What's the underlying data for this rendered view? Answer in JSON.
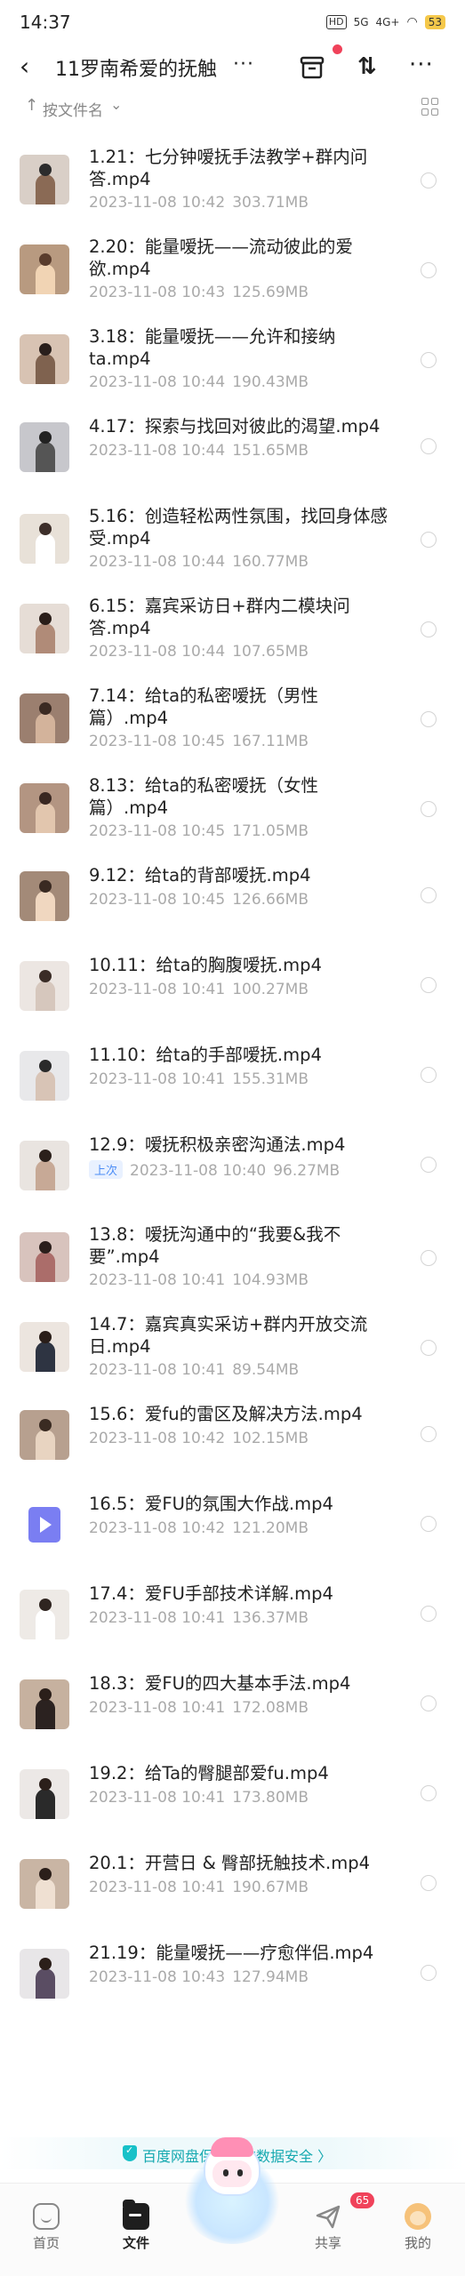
{
  "status_bar": {
    "time": "14:37",
    "hd": "HD",
    "sig1": "5G",
    "sig2": "4G+",
    "battery": "53"
  },
  "title_bar": {
    "title": "11罗南希爱的抚触",
    "ellipsis": "···",
    "sort_icon": "⇅",
    "more": "···"
  },
  "sort_bar": {
    "label": "按文件名",
    "arrow": "↑",
    "chevron": "⌄"
  },
  "files": [
    {
      "name": "1.21：七分钟嗳抚手法教学+群内问答.mp4",
      "date": "2023-11-08  10:42",
      "size": "303.71MB",
      "lines": 2
    },
    {
      "name": "2.20：能量嗳抚——流动彼此的爱欲.mp4",
      "date": "2023-11-08  10:43",
      "size": "125.69MB",
      "lines": 2
    },
    {
      "name": "3.18：能量嗳抚——允许和接纳ta.mp4",
      "date": "2023-11-08  10:44",
      "size": "190.43MB",
      "lines": 2
    },
    {
      "name": "4.17：探索与找回对彼此的渴望.mp4",
      "date": "2023-11-08  10:44",
      "size": "151.65MB",
      "lines": 1
    },
    {
      "name": "5.16：创造轻松两性氛围，找回身体感受.mp4",
      "date": "2023-11-08  10:44",
      "size": "160.77MB",
      "lines": 2
    },
    {
      "name": "6.15：嘉宾采访日+群内二模块问答.mp4",
      "date": "2023-11-08  10:44",
      "size": "107.65MB",
      "lines": 2
    },
    {
      "name": "7.14：给ta的私密嗳抚（男性篇）.mp4",
      "date": "2023-11-08  10:45",
      "size": "167.11MB",
      "lines": 2
    },
    {
      "name": "8.13：给ta的私密嗳抚（女性篇）.mp4",
      "date": "2023-11-08  10:45",
      "size": "171.05MB",
      "lines": 2
    },
    {
      "name": "9.12：给ta的背部嗳抚.mp4",
      "date": "2023-11-08  10:45",
      "size": "126.66MB",
      "lines": 1
    },
    {
      "name": "10.11：给ta的胸腹嗳抚.mp4",
      "date": "2023-11-08  10:41",
      "size": "100.27MB",
      "lines": 1
    },
    {
      "name": "11.10：给ta的手部嗳抚.mp4",
      "date": "2023-11-08  10:41",
      "size": "155.31MB",
      "lines": 1
    },
    {
      "name": "12.9：嗳抚积极亲密沟通法.mp4",
      "date": "2023-11-08  10:40",
      "size": "96.27MB",
      "lines": 1,
      "tag": "上次"
    },
    {
      "name": "13.8：嗳抚沟通中的“我要&我不要”.mp4",
      "date": "2023-11-08  10:41",
      "size": "104.93MB",
      "lines": 2
    },
    {
      "name": "14.7：嘉宾真实采访+群内开放交流日.mp4",
      "date": "2023-11-08  10:41",
      "size": "89.54MB",
      "lines": 2
    },
    {
      "name": "15.6：爱fu的雷区及解决方法.mp4",
      "date": "2023-11-08  10:42",
      "size": "102.15MB",
      "lines": 1
    },
    {
      "name": "16.5：爱FU的氛围大作战.mp4",
      "date": "2023-11-08  10:42",
      "size": "121.20MB",
      "lines": 1,
      "video_icon": true
    },
    {
      "name": "17.4：爱FU手部技术详解.mp4",
      "date": "2023-11-08  10:41",
      "size": "136.37MB",
      "lines": 1
    },
    {
      "name": "18.3：爱FU的四大基本手法.mp4",
      "date": "2023-11-08  10:41",
      "size": "172.08MB",
      "lines": 1
    },
    {
      "name": "19.2：给Ta的臀腿部爱fu.mp4",
      "date": "2023-11-08  10:41",
      "size": "173.80MB",
      "lines": 1
    },
    {
      "name": "20.1：开营日 & 臀部抚触技术.mp4",
      "date": "2023-11-08  10:41",
      "size": "190.67MB",
      "lines": 1
    },
    {
      "name": "21.19：能量嗳抚——疗愈伴侣.mp4",
      "date": "2023-11-08  10:43",
      "size": "127.94MB",
      "lines": 1
    }
  ],
  "security_footer": {
    "text": "百度网盘保障你的数据安全 〉"
  },
  "tab_bar": {
    "home": "首页",
    "files": "文件",
    "share": "共享",
    "share_badge": "65",
    "mine": "我的"
  },
  "colors": {
    "accent": "#4c8df6",
    "badge": "#f0425a",
    "security": "#16a9b0",
    "video_icon": "#7a7ef2"
  }
}
